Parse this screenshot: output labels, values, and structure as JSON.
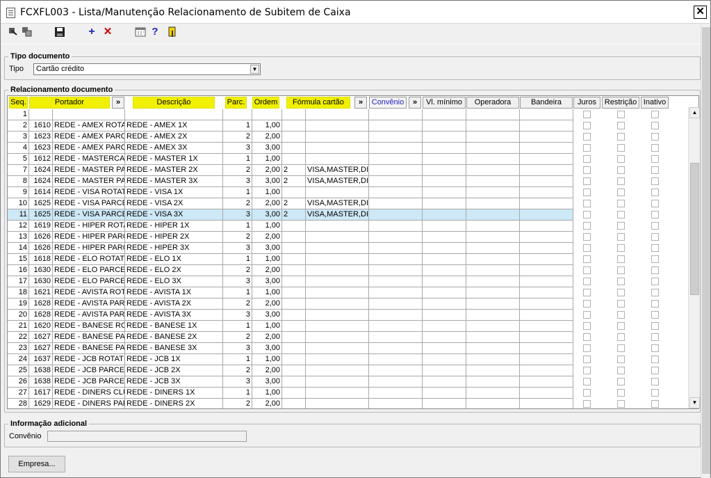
{
  "window": {
    "title": "FCXFL003 - Lista/Manutenção Relacionamento de Subitem de Caixa",
    "close": "✕"
  },
  "toolbar": [
    "go-first-icon",
    "copy-icon",
    "save-icon",
    "add-icon",
    "delete-icon",
    "calendar-icon",
    "help-icon",
    "exit-icon"
  ],
  "tipo_documento": {
    "legend": "Tipo documento",
    "label": "Tipo",
    "value": "Cartão crédito"
  },
  "relacionamento": {
    "legend": "Relacionamento documento",
    "headers": {
      "seq": "Seq.",
      "portador": "Portador",
      "more1": "»",
      "descricao": "Descrição",
      "parc": "Parc.",
      "ordem": "Ordem",
      "formula": "Fórmula cartão",
      "more2": "»",
      "convenio": "Convênio",
      "more3": "»",
      "vlminimo": "Vl. mínimo",
      "operadora": "Operadora",
      "bandeira": "Bandeira",
      "juros": "Juros",
      "restricao": "Restrição",
      "inativo": "Inativo"
    },
    "rows": [
      {
        "seq": "1",
        "cod": "",
        "portador": "",
        "descricao": "",
        "parc": "",
        "ordem": "",
        "f1": "",
        "f2": ""
      },
      {
        "seq": "2",
        "cod": "1610",
        "portador": "REDE - AMEX ROTATI",
        "descricao": "REDE - AMEX 1X",
        "parc": "1",
        "ordem": "1,00",
        "f1": "",
        "f2": ""
      },
      {
        "seq": "3",
        "cod": "1623",
        "portador": "REDE - AMEX PARCEI",
        "descricao": "REDE - AMEX 2X",
        "parc": "2",
        "ordem": "2,00",
        "f1": "",
        "f2": ""
      },
      {
        "seq": "4",
        "cod": "1623",
        "portador": "REDE - AMEX PARCEI",
        "descricao": "REDE - AMEX 3X",
        "parc": "3",
        "ordem": "3,00",
        "f1": "",
        "f2": ""
      },
      {
        "seq": "5",
        "cod": "1612",
        "portador": "REDE - MASTERCARI",
        "descricao": "REDE - MASTER 1X",
        "parc": "1",
        "ordem": "1,00",
        "f1": "",
        "f2": ""
      },
      {
        "seq": "7",
        "cod": "1624",
        "portador": "REDE - MASTER PAR",
        "descricao": "REDE - MASTER 2X",
        "parc": "2",
        "ordem": "2,00",
        "f1": "2",
        "f2": "VISA,MASTER,DIN"
      },
      {
        "seq": "8",
        "cod": "1624",
        "portador": "REDE - MASTER PAR",
        "descricao": "REDE - MASTER 3X",
        "parc": "3",
        "ordem": "3,00",
        "f1": "2",
        "f2": "VISA,MASTER,DIN"
      },
      {
        "seq": "9",
        "cod": "1614",
        "portador": "REDE - VISA ROTATIV",
        "descricao": "REDE - VISA 1X",
        "parc": "1",
        "ordem": "1,00",
        "f1": "",
        "f2": ""
      },
      {
        "seq": "10",
        "cod": "1625",
        "portador": "REDE - VISA PARCEL",
        "descricao": "REDE - VISA 2X",
        "parc": "2",
        "ordem": "2,00",
        "f1": "2",
        "f2": "VISA,MASTER,DIN"
      },
      {
        "seq": "11",
        "cod": "1625",
        "portador": "REDE - VISA PARCEL",
        "descricao": "REDE - VISA 3X",
        "parc": "3",
        "ordem": "3,00",
        "f1": "2",
        "f2": "VISA,MASTER,DIN"
      },
      {
        "seq": "12",
        "cod": "1619",
        "portador": "REDE - HIPER ROTATI",
        "descricao": "REDE - HIPER 1X",
        "parc": "1",
        "ordem": "1,00",
        "f1": "",
        "f2": ""
      },
      {
        "seq": "13",
        "cod": "1626",
        "portador": "REDE - HIPER PARCEI",
        "descricao": "REDE - HIPER 2X",
        "parc": "2",
        "ordem": "2,00",
        "f1": "",
        "f2": ""
      },
      {
        "seq": "14",
        "cod": "1626",
        "portador": "REDE - HIPER PARCEI",
        "descricao": "REDE - HIPER 3X",
        "parc": "3",
        "ordem": "3,00",
        "f1": "",
        "f2": ""
      },
      {
        "seq": "15",
        "cod": "1618",
        "portador": "REDE - ELO ROTATIV",
        "descricao": "REDE - ELO 1X",
        "parc": "1",
        "ordem": "1,00",
        "f1": "",
        "f2": ""
      },
      {
        "seq": "16",
        "cod": "1630",
        "portador": "REDE - ELO PARCELA",
        "descricao": "REDE - ELO 2X",
        "parc": "2",
        "ordem": "2,00",
        "f1": "",
        "f2": ""
      },
      {
        "seq": "17",
        "cod": "1630",
        "portador": "REDE - ELO PARCELA",
        "descricao": "REDE - ELO 3X",
        "parc": "3",
        "ordem": "3,00",
        "f1": "",
        "f2": ""
      },
      {
        "seq": "18",
        "cod": "1621",
        "portador": "REDE - AVISTA ROTA",
        "descricao": "REDE - AVISTA 1X",
        "parc": "1",
        "ordem": "1,00",
        "f1": "",
        "f2": ""
      },
      {
        "seq": "19",
        "cod": "1628",
        "portador": "REDE - AVISTA PARC",
        "descricao": "REDE - AVISTA 2X",
        "parc": "2",
        "ordem": "2,00",
        "f1": "",
        "f2": ""
      },
      {
        "seq": "20",
        "cod": "1628",
        "portador": "REDE - AVISTA PARC",
        "descricao": "REDE - AVISTA 3X",
        "parc": "3",
        "ordem": "3,00",
        "f1": "",
        "f2": ""
      },
      {
        "seq": "21",
        "cod": "1620",
        "portador": "REDE - BANESE ROT.",
        "descricao": "REDE - BANESE 1X",
        "parc": "1",
        "ordem": "1,00",
        "f1": "",
        "f2": ""
      },
      {
        "seq": "22",
        "cod": "1627",
        "portador": "REDE - BANESE PAR(",
        "descricao": "REDE - BANESE 2X",
        "parc": "2",
        "ordem": "2,00",
        "f1": "",
        "f2": ""
      },
      {
        "seq": "23",
        "cod": "1627",
        "portador": "REDE - BANESE PAR(",
        "descricao": "REDE - BANESE 3X",
        "parc": "3",
        "ordem": "3,00",
        "f1": "",
        "f2": ""
      },
      {
        "seq": "24",
        "cod": "1637",
        "portador": "REDE - JCB ROTATIV",
        "descricao": "REDE - JCB 1X",
        "parc": "1",
        "ordem": "1,00",
        "f1": "",
        "f2": ""
      },
      {
        "seq": "25",
        "cod": "1638",
        "portador": "REDE - JCB PARCELA",
        "descricao": "REDE - JCB 2X",
        "parc": "2",
        "ordem": "2,00",
        "f1": "",
        "f2": ""
      },
      {
        "seq": "26",
        "cod": "1638",
        "portador": "REDE - JCB PARCELA",
        "descricao": "REDE - JCB 3X",
        "parc": "3",
        "ordem": "3,00",
        "f1": "",
        "f2": ""
      },
      {
        "seq": "27",
        "cod": "1617",
        "portador": "REDE - DINERS CLUB",
        "descricao": "REDE - DINERS 1X",
        "parc": "1",
        "ordem": "1,00",
        "f1": "",
        "f2": ""
      },
      {
        "seq": "28",
        "cod": "1629",
        "portador": "REDE - DINERS PARC",
        "descricao": "REDE - DINERS 2X",
        "parc": "2",
        "ordem": "2,00",
        "f1": "",
        "f2": ""
      }
    ],
    "selected_seq": "11"
  },
  "info_adicional": {
    "legend": "Informação adicional",
    "label": "Convênio",
    "value": ""
  },
  "footer": {
    "empresa_button": "Empresa..."
  }
}
